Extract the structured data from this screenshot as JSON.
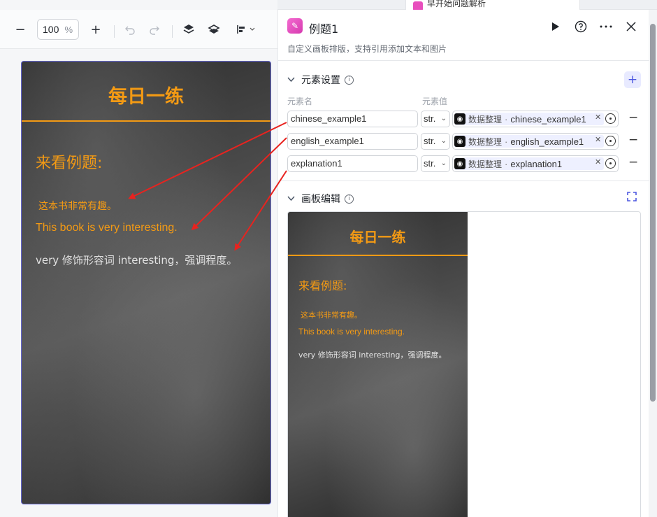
{
  "top_tab": {
    "label": "早开始问题解析"
  },
  "toolbar": {
    "zoom_value": "100",
    "zoom_unit": "%"
  },
  "board": {
    "title": "每日一练",
    "heading": "来看例题:",
    "chinese": "这本书非常有趣。",
    "english": "This book is very interesting.",
    "explanation": "very 修饰形容词 interesting，强调程度。"
  },
  "panel": {
    "title": "例题1",
    "description": "自定义画板排版，支持引用添加文本和图片",
    "elements_section": {
      "title": "元素设置",
      "col_name": "元素名",
      "col_value": "元素值",
      "rows": [
        {
          "name": "chinese_example1",
          "type": "str.",
          "source": "数据整理",
          "variable": "chinese_example1"
        },
        {
          "name": "english_example1",
          "type": "str.",
          "source": "数据整理",
          "variable": "english_example1"
        },
        {
          "name": "explanation1",
          "type": "str.",
          "source": "数据整理",
          "variable": "explanation1"
        }
      ]
    },
    "canvas_section": {
      "title": "画板编辑"
    }
  },
  "colors": {
    "accent_orange": "#f39a14",
    "brand_purple": "#4c56e0",
    "arrow_red": "#e8231f"
  }
}
